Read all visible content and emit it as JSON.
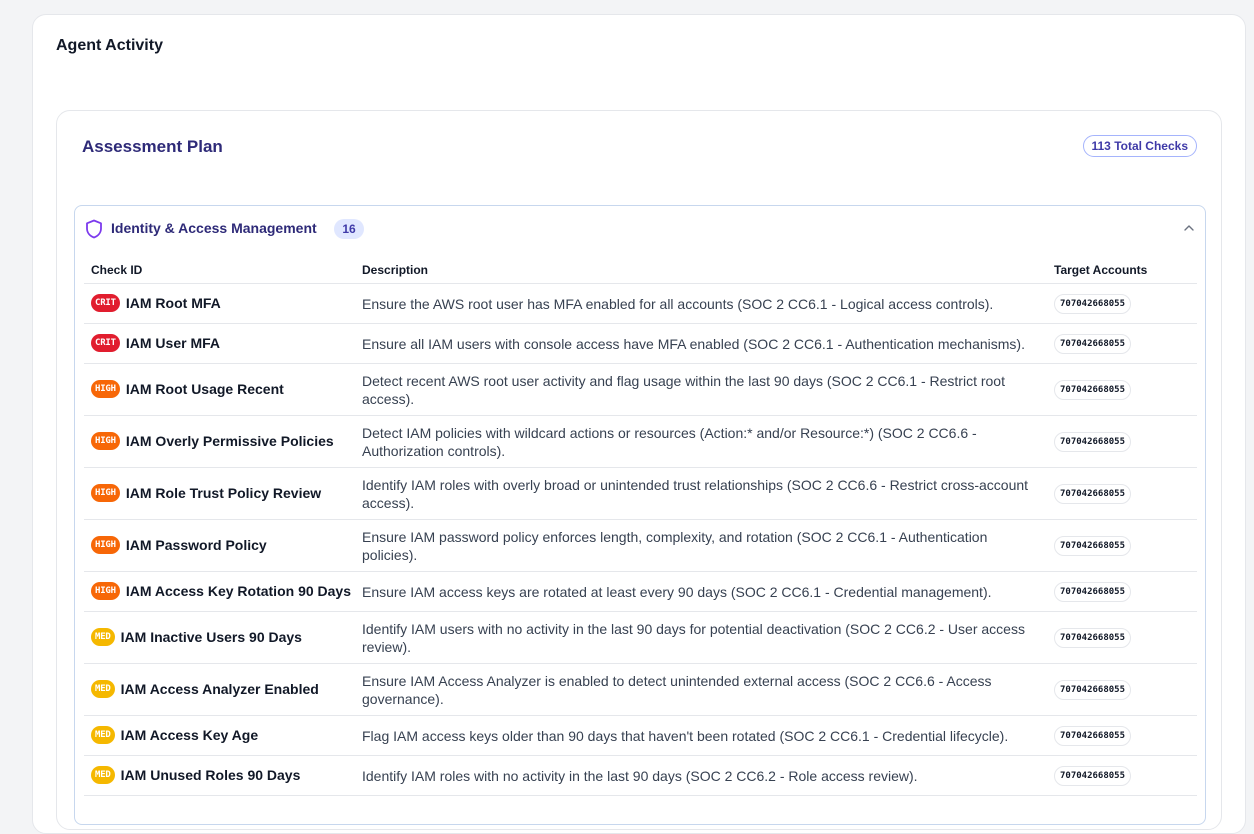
{
  "page": {
    "title": "Agent Activity"
  },
  "plan": {
    "title": "Assessment Plan",
    "total_checks": "113 Total Checks",
    "category": {
      "icon": "shield-icon",
      "title": "Identity & Access Management",
      "count": "16",
      "collapse_icon": "chevron-up-icon"
    },
    "columns": {
      "check_id": "Check ID",
      "description": "Description",
      "target_accounts": "Target Accounts"
    },
    "rows": [
      {
        "severity": "CRIT",
        "name": "IAM Root MFA",
        "description": "Ensure the AWS root user has MFA enabled for all accounts (SOC 2 CC6.1 - Logical access controls).",
        "account": "707042668055"
      },
      {
        "severity": "CRIT",
        "name": "IAM User MFA",
        "description": "Ensure all IAM users with console access have MFA enabled (SOC 2 CC6.1 - Authentication mechanisms).",
        "account": "707042668055"
      },
      {
        "severity": "HIGH",
        "name": "IAM Root Usage Recent",
        "description": "Detect recent AWS root user activity and flag usage within the last 90 days (SOC 2 CC6.1 - Restrict root access).",
        "account": "707042668055"
      },
      {
        "severity": "HIGH",
        "name": "IAM Overly Permissive Policies",
        "description": "Detect IAM policies with wildcard actions or resources (Action:* and/or Resource:*) (SOC 2 CC6.6 - Authorization controls).",
        "account": "707042668055"
      },
      {
        "severity": "HIGH",
        "name": "IAM Role Trust Policy Review",
        "description": "Identify IAM roles with overly broad or unintended trust relationships (SOC 2 CC6.6 - Restrict cross-account access).",
        "account": "707042668055"
      },
      {
        "severity": "HIGH",
        "name": "IAM Password Policy",
        "description": "Ensure IAM password policy enforces length, complexity, and rotation (SOC 2 CC6.1 - Authentication policies).",
        "account": "707042668055"
      },
      {
        "severity": "HIGH",
        "name": "IAM Access Key Rotation 90 Days",
        "description": "Ensure IAM access keys are rotated at least every 90 days (SOC 2 CC6.1 - Credential management).",
        "account": "707042668055"
      },
      {
        "severity": "MED",
        "name": "IAM Inactive Users 90 Days",
        "description": "Identify IAM users with no activity in the last 90 days for potential deactivation (SOC 2 CC6.2 - User access review).",
        "account": "707042668055"
      },
      {
        "severity": "MED",
        "name": "IAM Access Analyzer Enabled",
        "description": "Ensure IAM Access Analyzer is enabled to detect unintended external access (SOC 2 CC6.6 - Access governance).",
        "account": "707042668055"
      },
      {
        "severity": "MED",
        "name": "IAM Access Key Age",
        "description": "Flag IAM access keys older than 90 days that haven't been rotated (SOC 2 CC6.1 - Credential lifecycle).",
        "account": "707042668055"
      },
      {
        "severity": "MED",
        "name": "IAM Unused Roles 90 Days",
        "description": "Identify IAM roles with no activity in the last 90 days (SOC 2 CC6.2 - Role access review).",
        "account": "707042668055"
      }
    ]
  },
  "colors": {
    "crit": "#e11d2e",
    "high": "#f76707",
    "med": "#f5b800",
    "accent": "#2e2a78"
  }
}
